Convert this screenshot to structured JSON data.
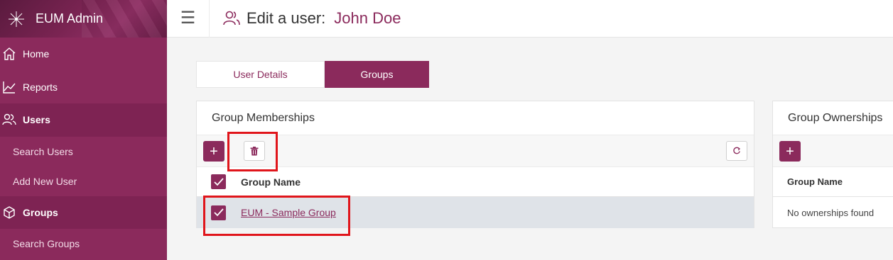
{
  "app": {
    "brand_name": "EUM Admin"
  },
  "sidebar": {
    "items": [
      {
        "label": "Home",
        "icon": "home-icon"
      },
      {
        "label": "Reports",
        "icon": "chart-line-icon"
      },
      {
        "label": "Users",
        "icon": "users-icon"
      },
      {
        "label": "Search Users"
      },
      {
        "label": "Add New User"
      },
      {
        "label": "Groups",
        "icon": "cube-icon"
      },
      {
        "label": "Search Groups"
      }
    ]
  },
  "header": {
    "title": "Edit a user:",
    "user_name": "John Doe"
  },
  "tabs": [
    {
      "label": "User Details",
      "active": false
    },
    {
      "label": "Groups",
      "active": true
    }
  ],
  "memberships": {
    "title": "Group Memberships",
    "column_header": "Group Name",
    "rows": [
      {
        "name": "EUM - Sample Group",
        "checked": true
      }
    ]
  },
  "ownerships": {
    "title": "Group Ownerships",
    "column_header": "Group Name",
    "empty_text": "No ownerships found"
  },
  "colors": {
    "primary": "#8b2a5c",
    "highlight": "#e0151b"
  }
}
